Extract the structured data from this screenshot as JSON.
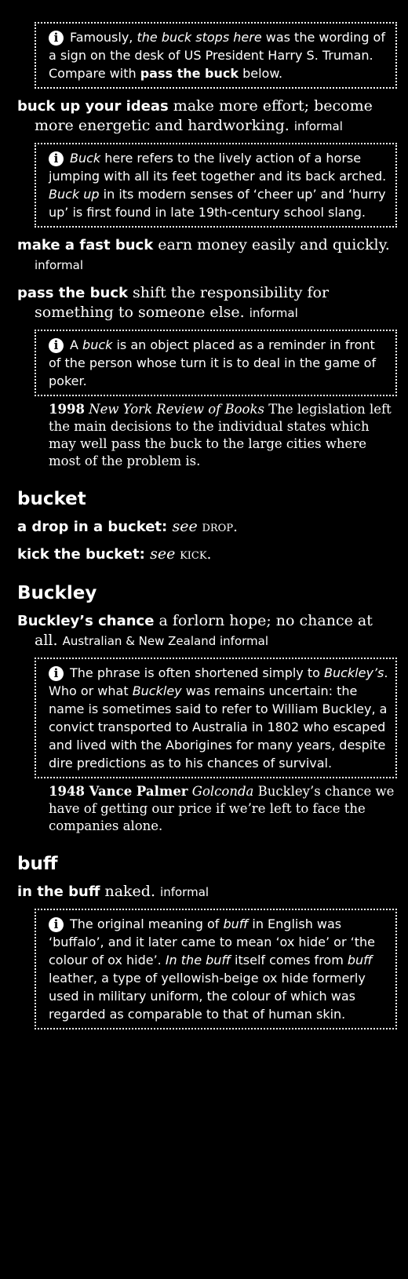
{
  "note1": {
    "pre": "Famously, ",
    "em1": "the buck stops here",
    "mid": " was the wording of a sign on the desk of US President Harry S. Truman. Compare with ",
    "b1": "pass the buck",
    "post": " below."
  },
  "entry_buck_up": {
    "hw": "buck up your ideas",
    "def": " make more effort; become more energetic and hardworking. ",
    "reg": "informal"
  },
  "note2": {
    "em1": "Buck",
    "mid1": " here refers to the lively action of a horse jumping with all its feet together and its back arched. ",
    "em2": "Buck up",
    "mid2": " in its modern senses of ‘cheer up’ and ‘hurry up’ is first found in late 19th-century school slang."
  },
  "entry_fast_buck": {
    "hw": "make a fast buck",
    "def": " earn money easily and quickly. ",
    "reg": "informal"
  },
  "entry_pass_buck": {
    "hw": "pass the buck",
    "def": " shift the responsibility for something to someone else. ",
    "reg": "informal"
  },
  "note3": {
    "pre": "A ",
    "em1": "buck",
    "post": " is an object placed as a reminder in front of the person whose turn it is to deal in the game of poker."
  },
  "quote1": {
    "yr": "1998",
    "src": " New York Review of Books",
    "text": " The legislation left the main decisions to the individual states which may well pass the buck to the large cities where most of the problem is."
  },
  "head_bucket": "bucket",
  "entry_drop": {
    "hw": "a drop in a bucket",
    "colon": ": ",
    "see": "see",
    "ref": " drop."
  },
  "entry_kick": {
    "hw": "kick the bucket",
    "colon": ": ",
    "see": "see",
    "ref": " kick."
  },
  "head_buckley": "Buckley",
  "entry_buckley": {
    "hw": "Buckley’s chance",
    "def": " a forlorn hope; no chance at all. ",
    "reg": "Australian & New Zealand informal"
  },
  "note4": {
    "pre": "The phrase is often shortened simply to ",
    "em1": "Buckley’s",
    "mid1": ". Who or what ",
    "em2": "Buckley",
    "post": " was remains uncertain: the name is sometimes said to refer to William Buckley, a convict transported to Australia in 1802 who escaped and lived with the Aborigines for many years, despite dire predictions as to his chances of survival."
  },
  "quote2": {
    "yr": "1948 Vance Palmer",
    "src": " Golconda",
    "text": " Buckley’s chance we have of getting our price if we’re left to face the companies alone."
  },
  "head_buff": "buff",
  "entry_buff": {
    "hw": "in the buff",
    "def": " naked. ",
    "reg": "informal"
  },
  "note5": {
    "pre": "The original meaning of ",
    "em1": "buff",
    "mid1": " in English was ‘buffalo’, and it later came to mean ‘ox hide’ or ‘the colour of ox hide’. ",
    "em2": "In the buff",
    "mid2": " itself comes from ",
    "em3": "buff",
    "post": " leather, a type of yellowish-beige ox hide formerly used in military uniform, the colour of which was regarded as comparable to that of human skin."
  },
  "info_glyph": "i"
}
